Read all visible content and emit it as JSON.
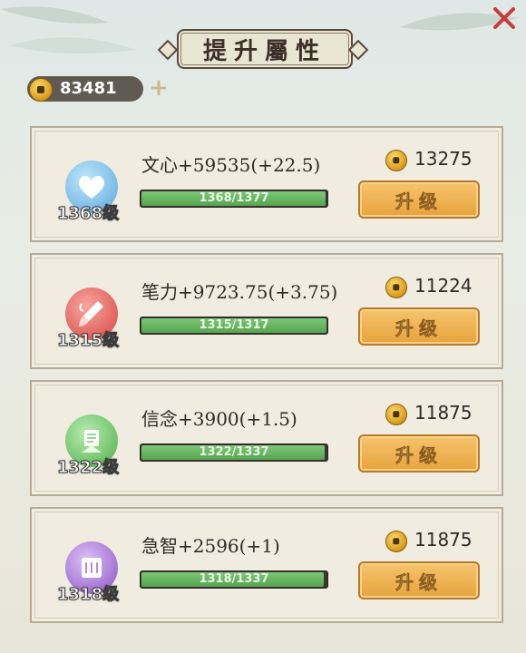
{
  "header": {
    "title": "提升屬性"
  },
  "currency": {
    "amount": "83481"
  },
  "attributes": [
    {
      "name": "文心+59535(+22.5)",
      "level": "1368级",
      "progress": "1368/1377",
      "progress_pct": 0.993,
      "cost": "13275",
      "button": "升级",
      "icon": "heart-icon",
      "color": "#6fb6e6"
    },
    {
      "name": "笔力+9723.75(+3.75)",
      "level": "1315级",
      "progress": "1315/1317",
      "progress_pct": 0.998,
      "cost": "11224",
      "button": "升级",
      "icon": "brush-icon",
      "color": "#e85b5b"
    },
    {
      "name": "信念+3900(+1.5)",
      "level": "1322级",
      "progress": "1322/1337",
      "progress_pct": 0.989,
      "cost": "11875",
      "button": "升级",
      "icon": "scroll-stand-icon",
      "color": "#68c65f"
    },
    {
      "name": "急智+2596(+1)",
      "level": "1318级",
      "progress": "1318/1337",
      "progress_pct": 0.986,
      "cost": "11875",
      "button": "升级",
      "icon": "scroll-icon",
      "color": "#a06ad3"
    }
  ]
}
